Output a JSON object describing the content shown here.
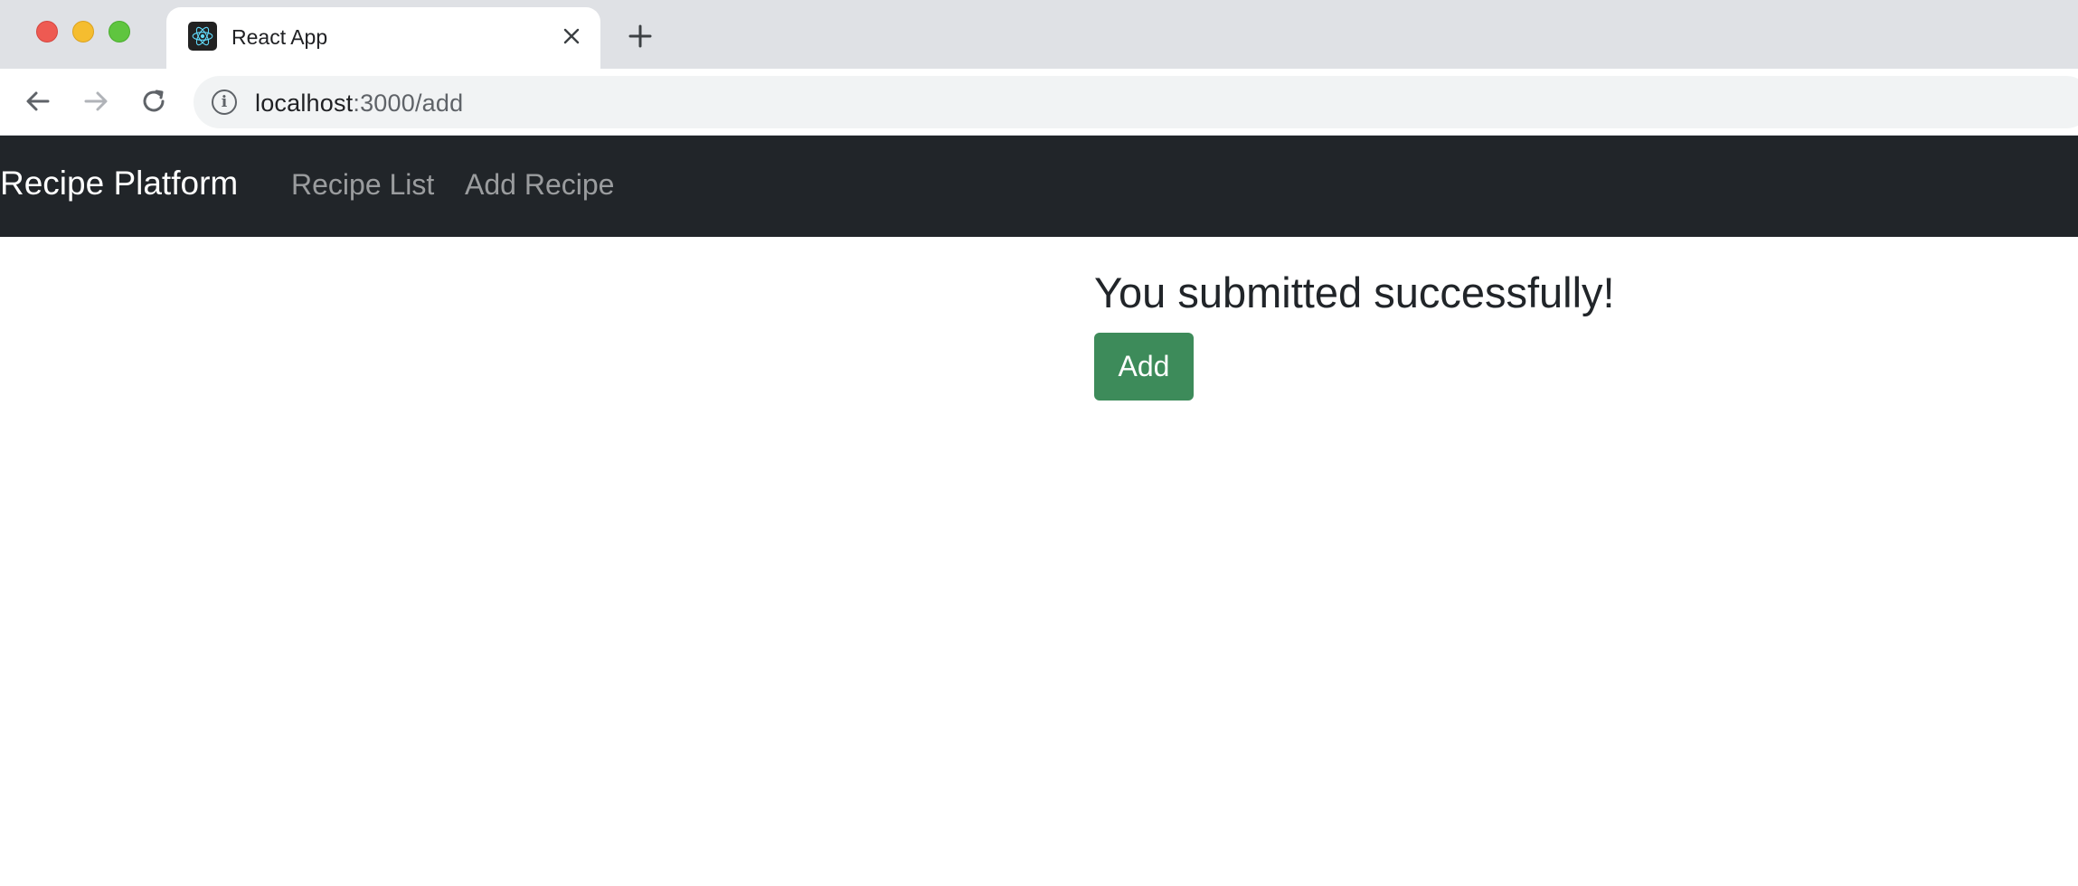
{
  "browser": {
    "tab_title": "React App",
    "tab_favicon": "react-logo-icon",
    "close_icon": "close-icon",
    "new_tab_icon": "plus-icon",
    "url_host": "localhost",
    "url_path": ":3000/add"
  },
  "navbar": {
    "brand": "Recipe Platform",
    "links": [
      {
        "label": "Recipe List"
      },
      {
        "label": "Add Recipe"
      }
    ],
    "background": "#212529"
  },
  "main": {
    "message": "You submitted successfully!",
    "add_button_label": "Add",
    "button_color": "#3d8b5a"
  }
}
